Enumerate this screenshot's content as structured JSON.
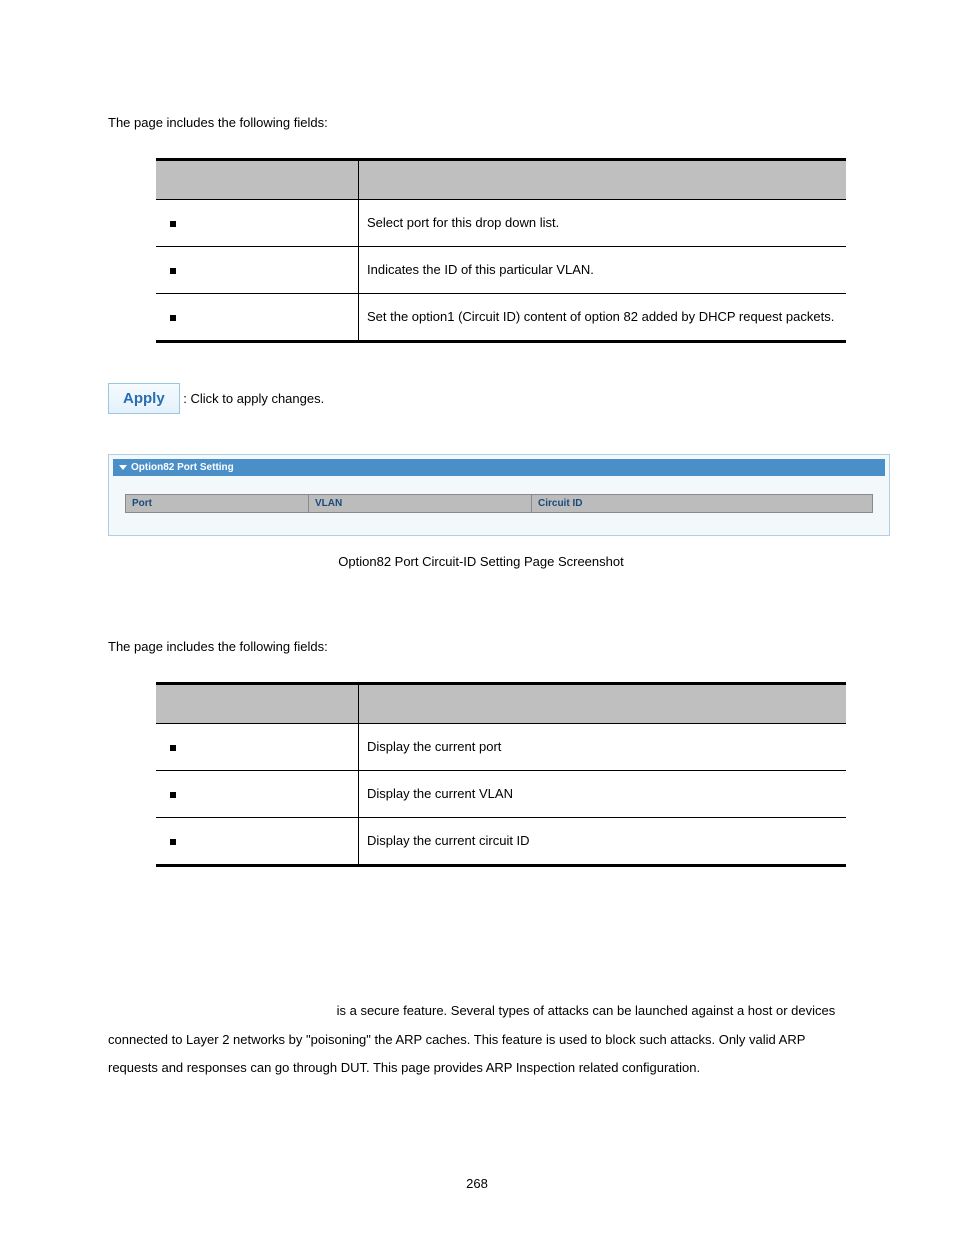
{
  "intro1": "The page includes the following fields:",
  "table1": {
    "rows": [
      {
        "desc": "Select port for this drop down list."
      },
      {
        "desc": "Indicates the ID of this particular VLAN."
      },
      {
        "desc": "Set the option1 (Circuit ID) content of option 82 added by DHCP request packets."
      }
    ]
  },
  "apply": {
    "button": "Apply",
    "text": ": Click to apply changes."
  },
  "screenshot": {
    "panel_title": "Option82 Port Setting",
    "cols": {
      "c1": "Port",
      "c2": "VLAN",
      "c3": "Circuit ID"
    }
  },
  "caption": "Option82 Port Circuit-ID Setting Page Screenshot",
  "intro2": "The page includes the following fields:",
  "table2": {
    "rows": [
      {
        "desc": "Display the current port"
      },
      {
        "desc": "Display the current VLAN"
      },
      {
        "desc": "Display the current circuit ID"
      }
    ]
  },
  "para": " is a secure feature. Several types of attacks can be launched against a host or devices connected to Layer 2 networks by \"poisoning\" the ARP caches. This feature is used to block such attacks. Only valid ARP requests and responses can go through DUT. This page provides ARP Inspection related configuration.",
  "pagenum": "268"
}
